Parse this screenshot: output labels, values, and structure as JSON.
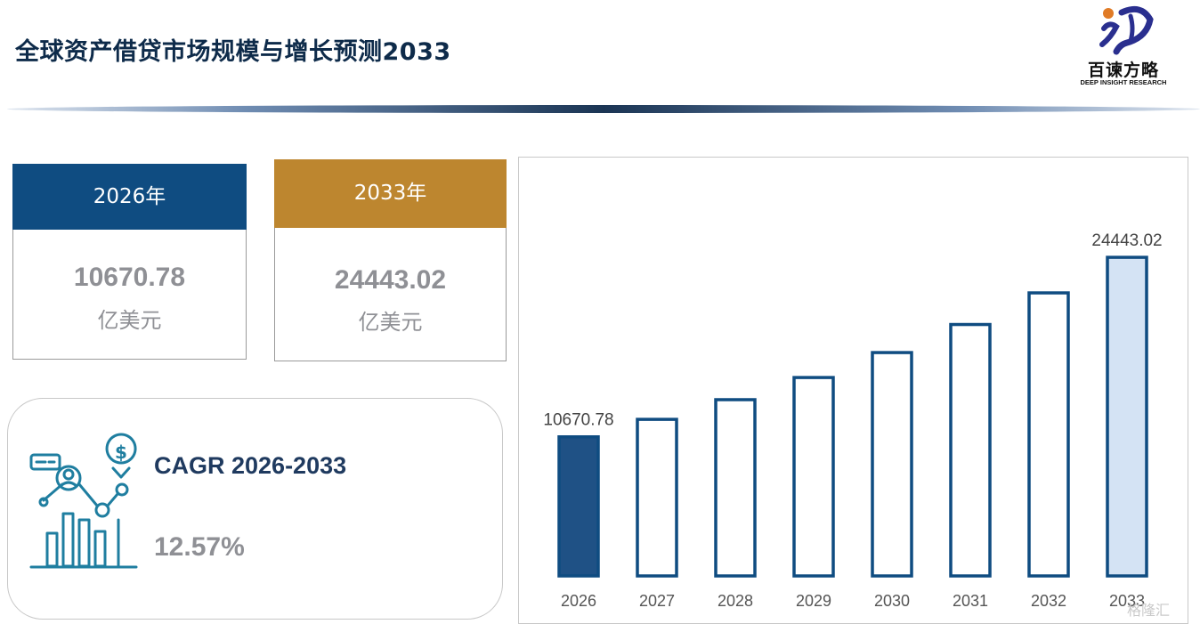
{
  "page": {
    "title": "全球资产借贷市场规模与增长预测2033",
    "watermark": "格隆汇"
  },
  "logo": {
    "name": "百谏方略",
    "tagline": "DEEP INSIGHT RESEARCH",
    "colors": {
      "primary": "#2a2f8f",
      "accent": "#e07b26"
    }
  },
  "cards": {
    "start": {
      "header": "2026年",
      "value": "10670.78",
      "unit": "亿美元",
      "color": "#0f4c81"
    },
    "end": {
      "header": "2033年",
      "value": "24443.02",
      "unit": "亿美元",
      "color": "#bd862f"
    }
  },
  "cagr": {
    "label": "CAGR 2026-2033",
    "value": "12.57%",
    "icon": "analytics-growth-icon"
  },
  "chart_data": {
    "type": "bar",
    "categories": [
      "2026",
      "2027",
      "2028",
      "2029",
      "2030",
      "2031",
      "2032",
      "2033"
    ],
    "values": [
      10670.78,
      12012,
      13522,
      15222,
      17136,
      19290,
      21715,
      24443.02
    ],
    "data_labels": {
      "0": "10670.78",
      "7": "24443.02"
    },
    "title": "",
    "xlabel": "",
    "ylabel": "",
    "ylim": [
      0,
      28000
    ],
    "grid": false,
    "legend": "none",
    "colors": {
      "outline": "#0f4c81",
      "first_fill": "#1f5185",
      "last_fill": "#d4e3f4",
      "default_fill": "#ffffff"
    }
  }
}
